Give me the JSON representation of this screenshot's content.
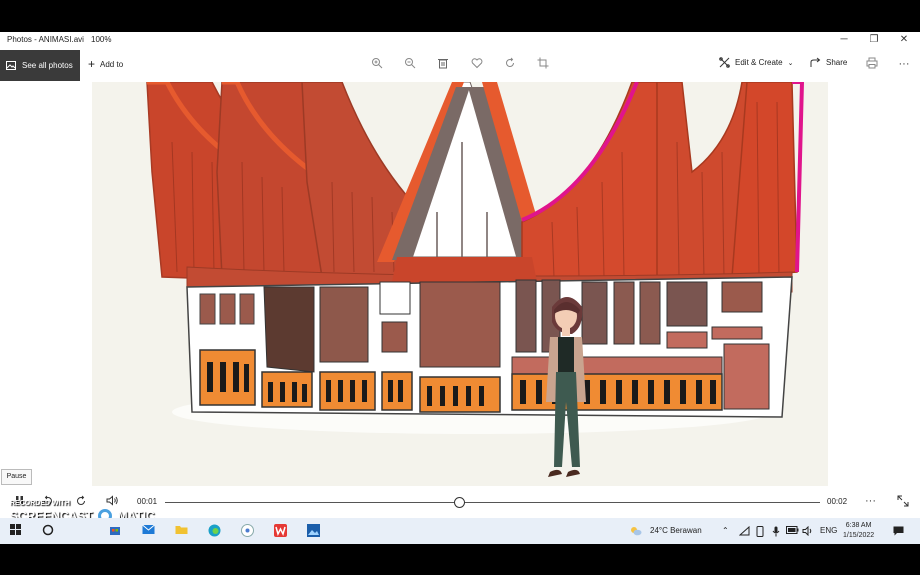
{
  "window": {
    "title": "Photos - ANIMASI.avi",
    "zoom": "100%",
    "minimize": "─",
    "restore": "❐",
    "close": "✕"
  },
  "toolbar": {
    "see_all_photos": "See all photos",
    "add_to": "Add to",
    "edit_create": "Edit & Create",
    "share": "Share",
    "more": "···"
  },
  "player": {
    "pause_tooltip": "Pause",
    "current_time": "00:01",
    "end_time": "00:02",
    "progress": 0.45,
    "more": "···"
  },
  "watermark": {
    "line1": "RECORDED WITH",
    "line2": "SCREENCAST",
    "line3": "MATIC"
  },
  "taskbar": {
    "weather": "24°C  Berawan",
    "language": "ENG",
    "time": "6:38 AM",
    "date": "1/15/2022"
  },
  "colors": {
    "roof_red": "#c9452b",
    "roof_orange": "#e65a2e",
    "roof_magenta": "#e0148c",
    "ridge_gray": "#7a6a66",
    "panel_brown": "#9b5a4c",
    "panel_orange": "#f08b33",
    "taskbar_bg": "#e8eff8"
  }
}
